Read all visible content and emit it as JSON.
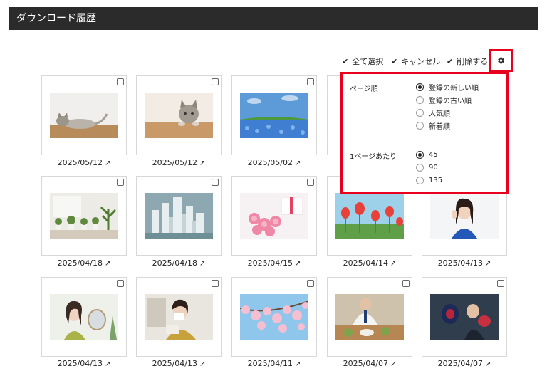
{
  "header": {
    "title": "ダウンロード履歴"
  },
  "toolbar": {
    "select_all": "全て選択",
    "cancel": "キャンセル",
    "delete": "削除する"
  },
  "popup": {
    "sort_label": "ページ順",
    "sort_options": [
      "登録の新しい順",
      "登録の古い順",
      "人気順",
      "新着順"
    ],
    "sort_selected": "登録の新しい順",
    "per_page_label": "1ページあたり",
    "per_page_options": [
      "45",
      "90",
      "135"
    ],
    "per_page_selected": "45"
  },
  "grid": {
    "rows": [
      [
        {
          "date": "2025/05/12",
          "subject": "cat-lying-icon"
        },
        {
          "date": "2025/05/12",
          "subject": "cat-peeking-icon"
        },
        {
          "date": "2025/05/02",
          "subject": "flower-field-icon"
        }
      ],
      [
        {
          "date": "2025/04/18",
          "subject": "houseplants-icon"
        },
        {
          "date": "2025/04/18",
          "subject": "city-model-icon"
        },
        {
          "date": "2025/04/15",
          "subject": "carnation-gift-icon"
        },
        {
          "date": "2025/04/14",
          "subject": "tulips-icon"
        },
        {
          "date": "2025/04/13",
          "subject": "woman-headache-icon"
        }
      ],
      [
        {
          "date": "2025/04/13",
          "subject": "woman-mirror-icon"
        },
        {
          "date": "2025/04/13",
          "subject": "woman-sneezing-icon"
        },
        {
          "date": "2025/04/11",
          "subject": "cherry-blossoms-icon"
        },
        {
          "date": "2025/04/07",
          "subject": "businessman-lunch-icon"
        },
        {
          "date": "2025/04/07",
          "subject": "boxing-mitts-icon"
        }
      ]
    ]
  },
  "colors": {
    "header_bg": "#2b2b2b",
    "highlight": "#e8001c"
  }
}
